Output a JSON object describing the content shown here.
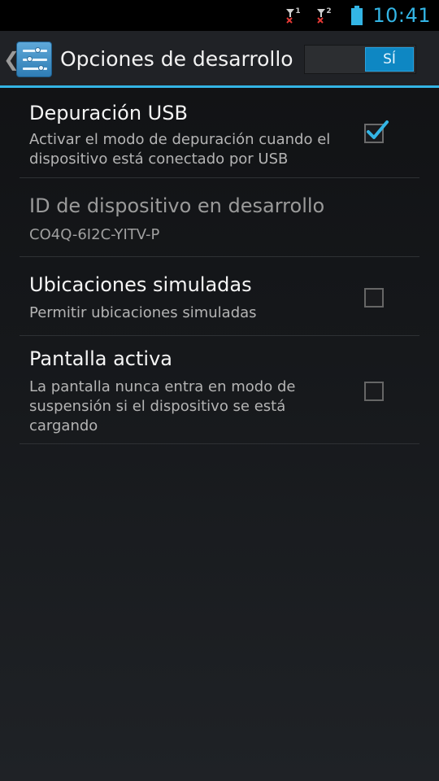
{
  "status_bar": {
    "sim1_label": "1",
    "sim2_label": "2",
    "time": "10:41",
    "colors": {
      "accent": "#33b5e5",
      "no_signal": "#e53935"
    },
    "icons": [
      "signal-sim1-no-service-icon",
      "signal-sim2-no-service-icon",
      "battery-icon"
    ]
  },
  "action_bar": {
    "title": "Opciones de desarrollo",
    "toggle_label": "SÍ",
    "toggle_on": true,
    "icons": [
      "up-chevron-icon",
      "developer-settings-icon"
    ]
  },
  "preferences": [
    {
      "title": "Depuración USB",
      "summary": "Activar el modo de depuración cuando el dispositivo está conectado por USB",
      "checked": true
    },
    {
      "title": "ID de dispositivo en desarrollo",
      "summary": "CO4Q-6I2C-YITV-P",
      "disabled": true
    },
    {
      "title": "Ubicaciones simuladas",
      "summary": "Permitir ubicaciones simuladas",
      "checked": false
    },
    {
      "title": "Pantalla activa",
      "summary": "La pantalla nunca entra en modo de suspensión si el dispositivo se está cargando",
      "checked": false
    }
  ]
}
